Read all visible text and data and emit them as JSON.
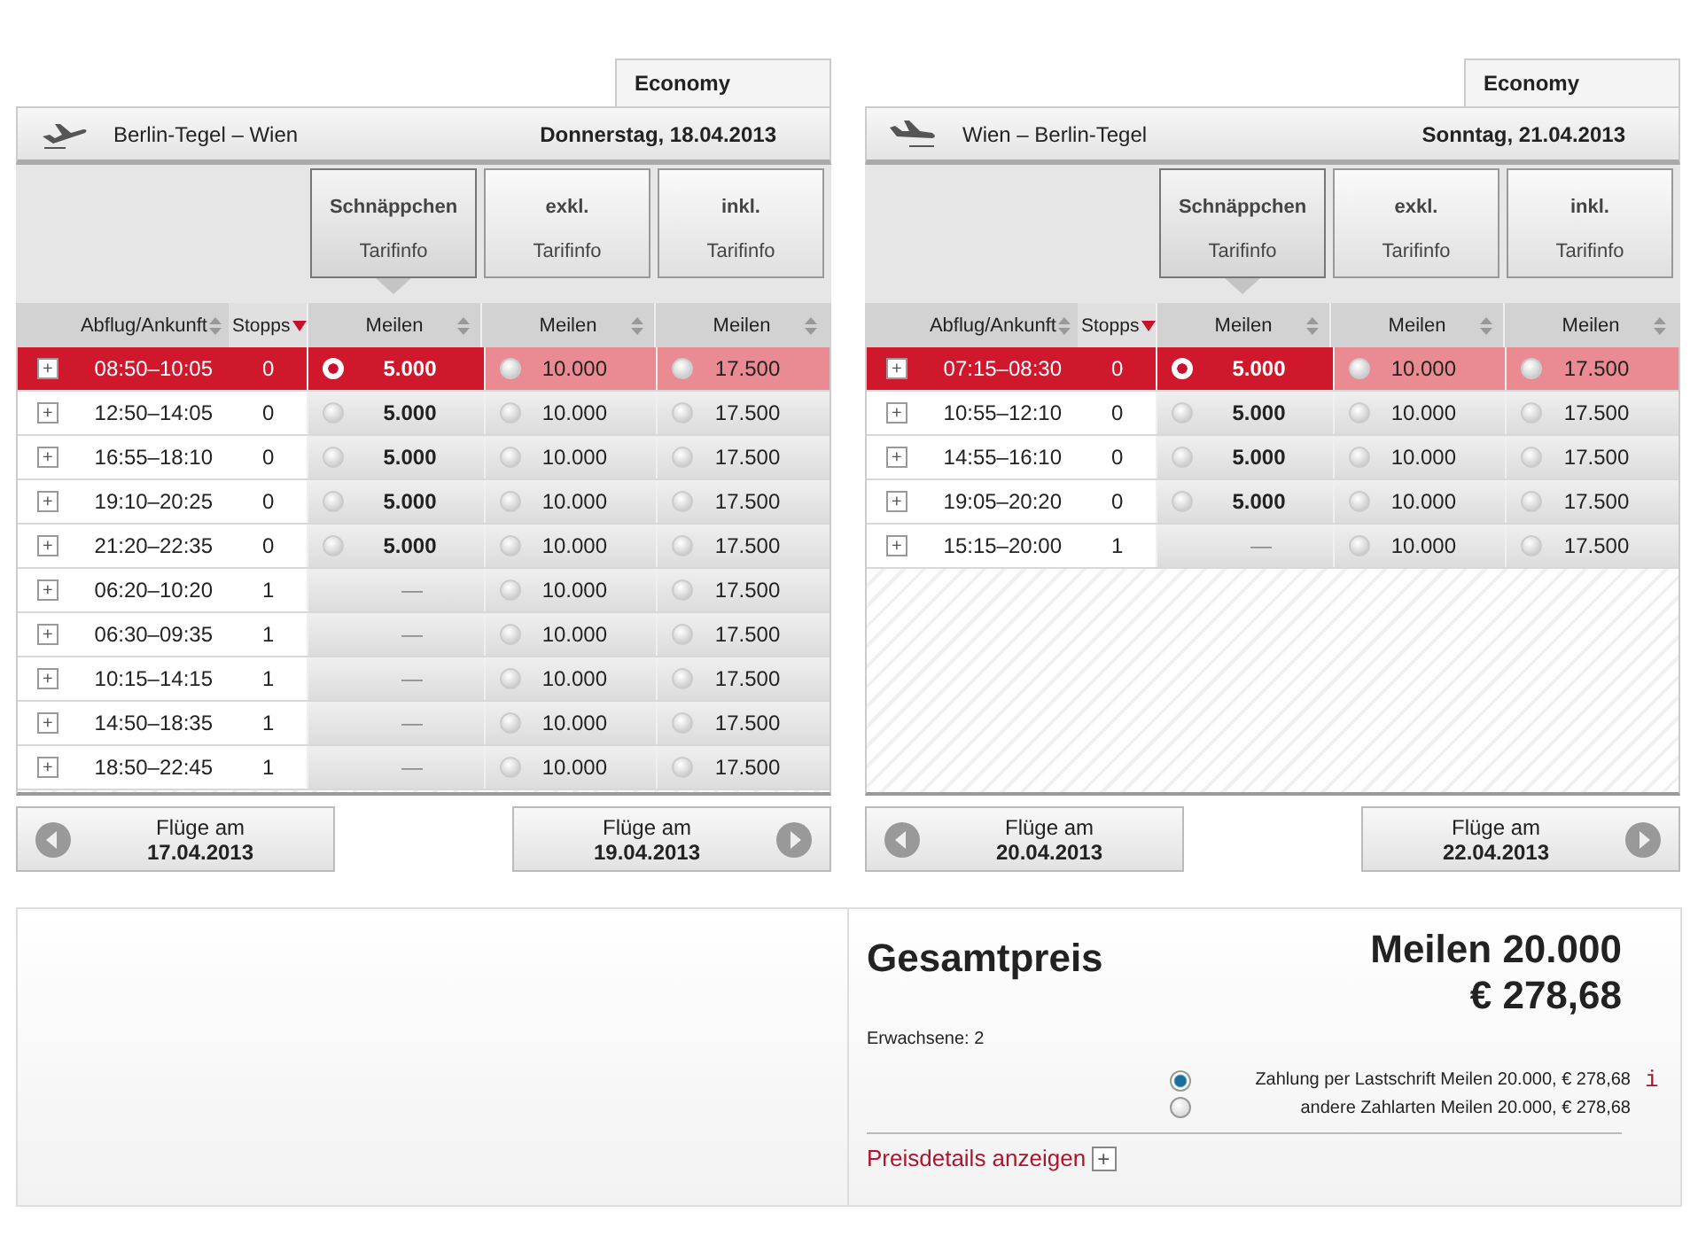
{
  "flights": [
    {
      "kind": "outbound",
      "cabin_tab": "Economy",
      "route": "Berlin-Tegel – Wien",
      "date": "Donnerstag, 18.04.2013",
      "fare_types": [
        {
          "name": "Schnäppchen",
          "info": "Tarifinfo",
          "selected": true
        },
        {
          "name": "exkl.",
          "info": "Tarifinfo",
          "selected": false
        },
        {
          "name": "inkl.",
          "info": "Tarifinfo",
          "selected": false
        }
      ],
      "columns": {
        "time": "Abflug/Ankunft",
        "stops": "Stopps",
        "fares": [
          "Meilen",
          "Meilen",
          "Meilen"
        ]
      },
      "rows": [
        {
          "expand": "+",
          "time": "08:50–10:05",
          "stops": "0",
          "selected": true,
          "fares": [
            {
              "kind": "radio",
              "value": "5.000",
              "selected": true
            },
            {
              "kind": "radio",
              "value": "10.000",
              "selected": false
            },
            {
              "kind": "radio",
              "value": "17.500",
              "selected": false
            }
          ]
        },
        {
          "expand": "+",
          "time": "12:50–14:05",
          "stops": "0",
          "selected": false,
          "fares": [
            {
              "kind": "radio",
              "value": "5.000",
              "selected": false
            },
            {
              "kind": "radio",
              "value": "10.000",
              "selected": false
            },
            {
              "kind": "radio",
              "value": "17.500",
              "selected": false
            }
          ]
        },
        {
          "expand": "+",
          "time": "16:55–18:10",
          "stops": "0",
          "selected": false,
          "fares": [
            {
              "kind": "radio",
              "value": "5.000",
              "selected": false
            },
            {
              "kind": "radio",
              "value": "10.000",
              "selected": false
            },
            {
              "kind": "radio",
              "value": "17.500",
              "selected": false
            }
          ]
        },
        {
          "expand": "+",
          "time": "19:10–20:25",
          "stops": "0",
          "selected": false,
          "fares": [
            {
              "kind": "radio",
              "value": "5.000",
              "selected": false
            },
            {
              "kind": "radio",
              "value": "10.000",
              "selected": false
            },
            {
              "kind": "radio",
              "value": "17.500",
              "selected": false
            }
          ]
        },
        {
          "expand": "+",
          "time": "21:20–22:35",
          "stops": "0",
          "selected": false,
          "fares": [
            {
              "kind": "radio",
              "value": "5.000",
              "selected": false
            },
            {
              "kind": "radio",
              "value": "10.000",
              "selected": false
            },
            {
              "kind": "radio",
              "value": "17.500",
              "selected": false
            }
          ]
        },
        {
          "expand": "+",
          "time": "06:20–10:20",
          "stops": "1",
          "selected": false,
          "fares": [
            {
              "kind": "none",
              "value": "—"
            },
            {
              "kind": "radio",
              "value": "10.000",
              "selected": false
            },
            {
              "kind": "radio",
              "value": "17.500",
              "selected": false
            }
          ]
        },
        {
          "expand": "+",
          "time": "06:30–09:35",
          "stops": "1",
          "selected": false,
          "fares": [
            {
              "kind": "none",
              "value": "—"
            },
            {
              "kind": "radio",
              "value": "10.000",
              "selected": false
            },
            {
              "kind": "radio",
              "value": "17.500",
              "selected": false
            }
          ]
        },
        {
          "expand": "+",
          "time": "10:15–14:15",
          "stops": "1",
          "selected": false,
          "fares": [
            {
              "kind": "none",
              "value": "—"
            },
            {
              "kind": "radio",
              "value": "10.000",
              "selected": false
            },
            {
              "kind": "radio",
              "value": "17.500",
              "selected": false
            }
          ]
        },
        {
          "expand": "+",
          "time": "14:50–18:35",
          "stops": "1",
          "selected": false,
          "fares": [
            {
              "kind": "none",
              "value": "—"
            },
            {
              "kind": "radio",
              "value": "10.000",
              "selected": false
            },
            {
              "kind": "radio",
              "value": "17.500",
              "selected": false
            }
          ]
        },
        {
          "expand": "+",
          "time": "18:50–22:45",
          "stops": "1",
          "selected": false,
          "fares": [
            {
              "kind": "none",
              "value": "—"
            },
            {
              "kind": "radio",
              "value": "10.000",
              "selected": false
            },
            {
              "kind": "radio",
              "value": "17.500",
              "selected": false
            }
          ]
        }
      ],
      "prev": {
        "label": "Flüge am",
        "date": "17.04.2013"
      },
      "next": {
        "label": "Flüge am",
        "date": "19.04.2013"
      }
    },
    {
      "kind": "return",
      "cabin_tab": "Economy",
      "route": "Wien – Berlin-Tegel",
      "date": "Sonntag, 21.04.2013",
      "fare_types": [
        {
          "name": "Schnäppchen",
          "info": "Tarifinfo",
          "selected": true
        },
        {
          "name": "exkl.",
          "info": "Tarifinfo",
          "selected": false
        },
        {
          "name": "inkl.",
          "info": "Tarifinfo",
          "selected": false
        }
      ],
      "columns": {
        "time": "Abflug/Ankunft",
        "stops": "Stopps",
        "fares": [
          "Meilen",
          "Meilen",
          "Meilen"
        ]
      },
      "rows": [
        {
          "expand": "+",
          "time": "07:15–08:30",
          "stops": "0",
          "selected": true,
          "fares": [
            {
              "kind": "radio",
              "value": "5.000",
              "selected": true
            },
            {
              "kind": "radio",
              "value": "10.000",
              "selected": false
            },
            {
              "kind": "radio",
              "value": "17.500",
              "selected": false
            }
          ]
        },
        {
          "expand": "+",
          "time": "10:55–12:10",
          "stops": "0",
          "selected": false,
          "fares": [
            {
              "kind": "radio",
              "value": "5.000",
              "selected": false
            },
            {
              "kind": "radio",
              "value": "10.000",
              "selected": false
            },
            {
              "kind": "radio",
              "value": "17.500",
              "selected": false
            }
          ]
        },
        {
          "expand": "+",
          "time": "14:55–16:10",
          "stops": "0",
          "selected": false,
          "fares": [
            {
              "kind": "radio",
              "value": "5.000",
              "selected": false
            },
            {
              "kind": "radio",
              "value": "10.000",
              "selected": false
            },
            {
              "kind": "radio",
              "value": "17.500",
              "selected": false
            }
          ]
        },
        {
          "expand": "+",
          "time": "19:05–20:20",
          "stops": "0",
          "selected": false,
          "fares": [
            {
              "kind": "radio",
              "value": "5.000",
              "selected": false
            },
            {
              "kind": "radio",
              "value": "10.000",
              "selected": false
            },
            {
              "kind": "radio",
              "value": "17.500",
              "selected": false
            }
          ]
        },
        {
          "expand": "+",
          "time": "15:15–20:00",
          "stops": "1",
          "selected": false,
          "fares": [
            {
              "kind": "none",
              "value": "—"
            },
            {
              "kind": "radio",
              "value": "10.000",
              "selected": false
            },
            {
              "kind": "radio",
              "value": "17.500",
              "selected": false
            }
          ]
        }
      ],
      "prev": {
        "label": "Flüge am",
        "date": "20.04.2013"
      },
      "next": {
        "label": "Flüge am",
        "date": "22.04.2013"
      }
    }
  ],
  "summary": {
    "title": "Gesamtpreis",
    "miles": "Meilen 20.000",
    "price": "€ 278,68",
    "passengers": "Erwachsene: 2",
    "payment_options": [
      {
        "label": "Zahlung per Lastschrift Meilen 20.000, € 278,68",
        "selected": true,
        "info": "i"
      },
      {
        "label": "andere Zahlarten Meilen 20.000, € 278,68",
        "selected": false
      }
    ],
    "details_link": "Preisdetails anzeigen",
    "details_toggle": "+"
  }
}
